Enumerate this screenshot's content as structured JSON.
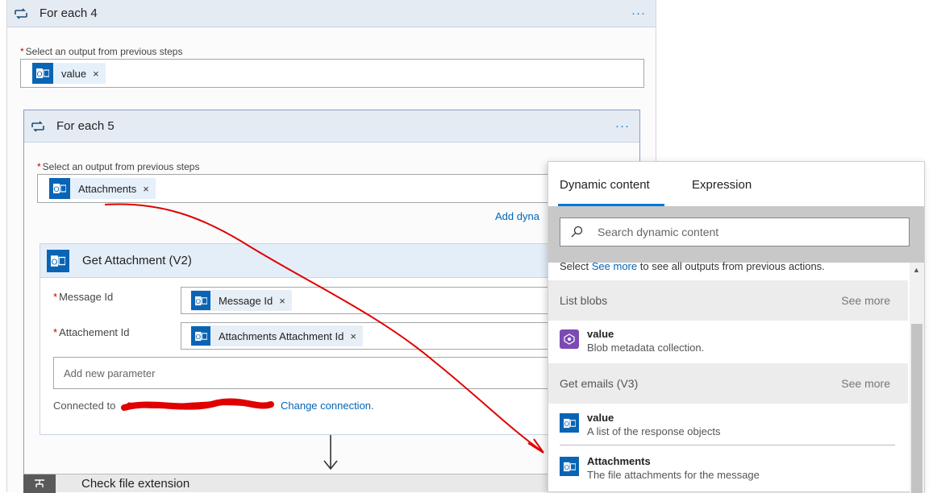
{
  "foreach4": {
    "title": "For each 4",
    "menu": "···",
    "select_label": "Select an output from previous steps",
    "token": "value",
    "token_remove": "×"
  },
  "foreach5": {
    "title": "For each 5",
    "menu": "···",
    "select_label": "Select an output from previous steps",
    "token": "Attachments",
    "token_remove": "×",
    "add_dynamic": "Add dyna"
  },
  "get_attachment": {
    "title": "Get Attachment (V2)",
    "message_id_label": "Message Id",
    "message_id_token": "Message Id",
    "attachment_id_label": "Attachement Id",
    "attachment_id_token": "Attachments Attachment Id",
    "token_remove": "×",
    "add_param_placeholder": "Add new parameter",
    "connected_prefix": "Connected to",
    "change_connection": "Change connection."
  },
  "next_step": {
    "title": "Check file extension"
  },
  "dynamic_panel": {
    "tabs": [
      "Dynamic content",
      "Expression"
    ],
    "search_placeholder": "Search dynamic content",
    "hint_pre": "Select ",
    "hint_link": "See more",
    "hint_post": " to see all outputs from previous actions.",
    "sections": [
      {
        "name": "List blobs",
        "see_more": "See more",
        "items": [
          {
            "name": "value",
            "desc": "Blob metadata collection."
          }
        ]
      },
      {
        "name": "Get emails (V3)",
        "see_more": "See more",
        "items": [
          {
            "name": "value",
            "desc": "A list of the response objects"
          },
          {
            "name": "Attachments",
            "desc": "The file attachments for the message"
          }
        ]
      }
    ]
  },
  "colors": {
    "accent": "#0078d4",
    "outlook_icon": "#0a64b4",
    "blob_icon": "#7b4bb3",
    "annotation_red": "#e00000"
  }
}
